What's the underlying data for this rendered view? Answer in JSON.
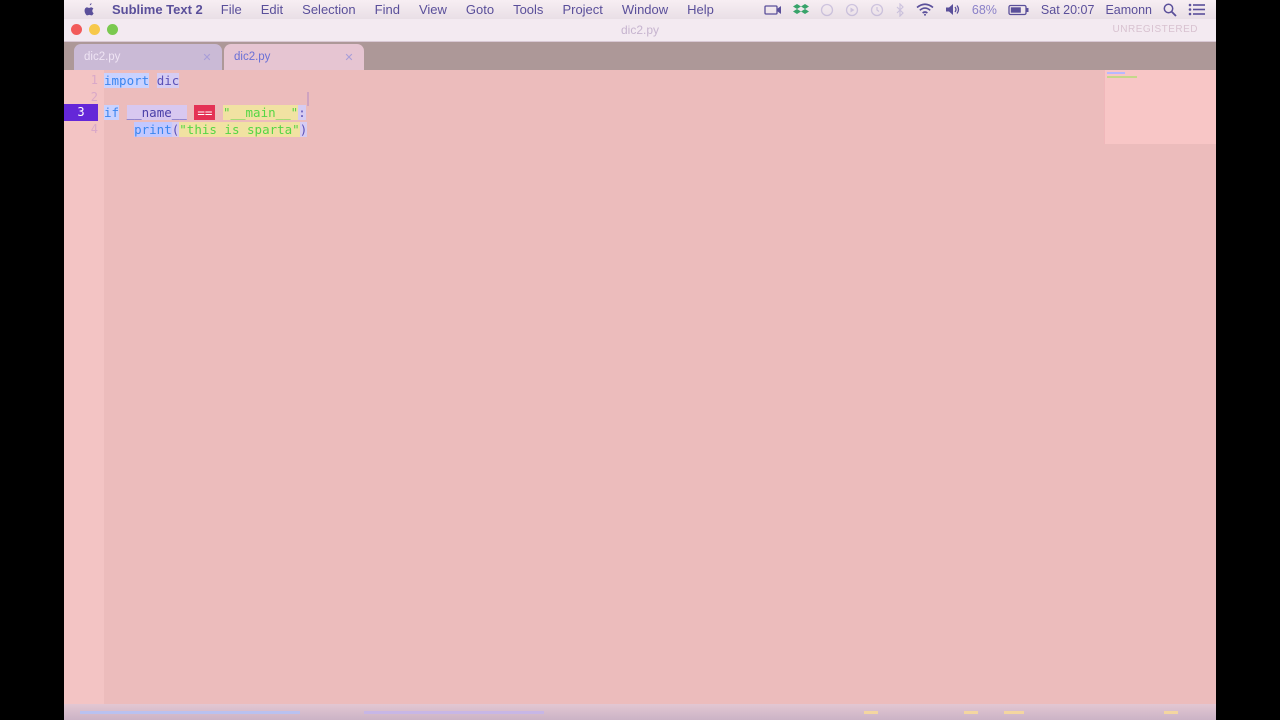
{
  "menubar": {
    "app_name": "Sublime Text 2",
    "items": [
      "File",
      "Edit",
      "Selection",
      "Find",
      "View",
      "Goto",
      "Tools",
      "Project",
      "Window",
      "Help"
    ],
    "status": {
      "battery": "68%",
      "datetime": "Sat 20:07",
      "user": "Eamonn"
    },
    "icons": [
      "apple-icon",
      "screen-record-icon",
      "dropbox-icon",
      "sync-icon",
      "media-icon",
      "time-machine-icon",
      "bluetooth-icon",
      "wifi-icon",
      "volume-icon",
      "battery-icon",
      "search-icon",
      "notification-list-icon"
    ]
  },
  "window": {
    "title": "dic2.py",
    "registration": "UNREGISTERED"
  },
  "tabs": [
    {
      "label": "dic2.py",
      "active": false
    },
    {
      "label": "dic2.py",
      "active": true
    }
  ],
  "editor": {
    "line_numbers": [
      "1",
      "2",
      "3",
      "4"
    ],
    "current_line": "3",
    "lines": [
      {
        "tokens": [
          {
            "t": "import",
            "c": "kw"
          },
          {
            "t": " ",
            "c": ""
          },
          {
            "t": "dic",
            "c": "id"
          }
        ]
      },
      {
        "tokens": []
      },
      {
        "tokens": [
          {
            "t": "if",
            "c": "kw"
          },
          {
            "t": " ",
            "c": ""
          },
          {
            "t": "__name__",
            "c": "dund"
          },
          {
            "t": " ",
            "c": ""
          },
          {
            "t": "==",
            "c": "op"
          },
          {
            "t": " ",
            "c": ""
          },
          {
            "t": "\"__main__\"",
            "c": "str"
          },
          {
            "t": ":",
            "c": "id"
          }
        ]
      },
      {
        "tokens": [
          {
            "t": "    ",
            "c": ""
          },
          {
            "t": "print",
            "c": "fn"
          },
          {
            "t": "(",
            "c": "paren"
          },
          {
            "t": "\"this is sparta\"",
            "c": "str"
          },
          {
            "t": ")",
            "c": "paren"
          }
        ]
      }
    ]
  },
  "colors": {
    "accent": "#6427d8",
    "editor_bg": "#ecbcbc",
    "keyword": "#3a86f0",
    "string": "#55d645",
    "operator": "#e43255"
  }
}
